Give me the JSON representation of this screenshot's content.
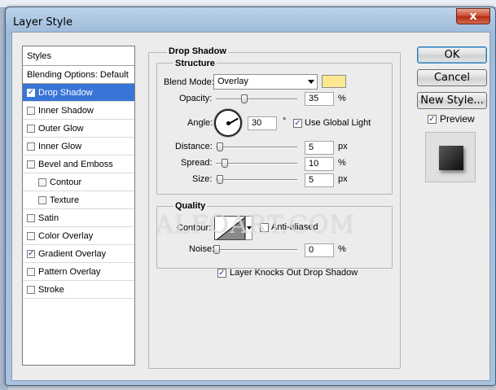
{
  "window": {
    "title": "Layer Style",
    "close": "x"
  },
  "styles_panel": {
    "header": "Styles",
    "blending": "Blending Options: Default",
    "items": [
      {
        "label": "Drop Shadow",
        "checked": true,
        "selected": true,
        "indent": false
      },
      {
        "label": "Inner Shadow",
        "checked": false,
        "selected": false,
        "indent": false
      },
      {
        "label": "Outer Glow",
        "checked": false,
        "selected": false,
        "indent": false
      },
      {
        "label": "Inner Glow",
        "checked": false,
        "selected": false,
        "indent": false
      },
      {
        "label": "Bevel and Emboss",
        "checked": false,
        "selected": false,
        "indent": false
      },
      {
        "label": "Contour",
        "checked": false,
        "selected": false,
        "indent": true
      },
      {
        "label": "Texture",
        "checked": false,
        "selected": false,
        "indent": true
      },
      {
        "label": "Satin",
        "checked": false,
        "selected": false,
        "indent": false
      },
      {
        "label": "Color Overlay",
        "checked": false,
        "selected": false,
        "indent": false
      },
      {
        "label": "Gradient Overlay",
        "checked": true,
        "selected": false,
        "indent": false
      },
      {
        "label": "Pattern Overlay",
        "checked": false,
        "selected": false,
        "indent": false
      },
      {
        "label": "Stroke",
        "checked": false,
        "selected": false,
        "indent": false
      }
    ]
  },
  "drop_shadow": {
    "group_title": "Drop Shadow",
    "structure_title": "Structure",
    "blend_mode_label": "Blend Mode:",
    "blend_mode_value": "Overlay",
    "shadow_color": "#fde891",
    "opacity_label": "Opacity:",
    "opacity_value": "35",
    "opacity_unit": "%",
    "opacity_level": 0.35,
    "angle_label": "Angle:",
    "angle_value": "30",
    "angle_unit": "°",
    "use_global_light_label": "Use Global Light",
    "use_global_light_checked": true,
    "distance_label": "Distance:",
    "distance_value": "5",
    "distance_unit": "px",
    "spread_label": "Spread:",
    "spread_value": "10",
    "spread_unit": "%",
    "size_label": "Size:",
    "size_value": "5",
    "size_unit": "px",
    "quality_title": "Quality",
    "contour_label": "Contour:",
    "anti_aliased_label": "Anti-aliased",
    "anti_aliased_checked": false,
    "noise_label": "Noise:",
    "noise_value": "0",
    "noise_unit": "%",
    "knockout_label": "Layer Knocks Out Drop Shadow",
    "knockout_checked": true
  },
  "buttons": {
    "ok": "OK",
    "cancel": "Cancel",
    "new_style": "New Style...",
    "preview_label": "Preview",
    "preview_checked": true
  },
  "watermark": "ALFOART.COM"
}
